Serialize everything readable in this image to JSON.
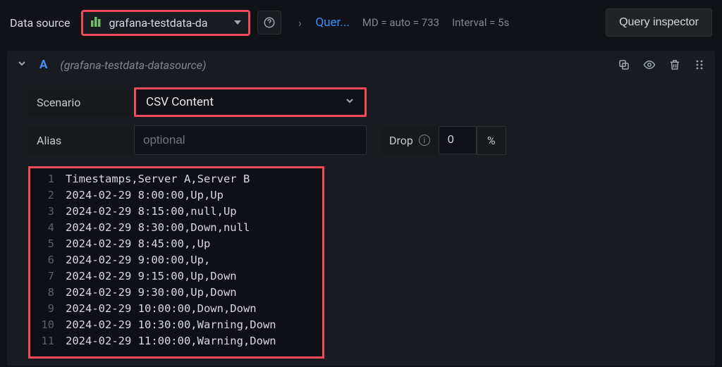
{
  "topbar": {
    "ds_label": "Data source",
    "ds_name": "grafana-testdata-da",
    "breadcrumb_link": "Quer...",
    "stat_md": "MD = auto = 733",
    "stat_interval": "Interval = 5s",
    "inspector_label": "Query inspector"
  },
  "query": {
    "letter": "A",
    "source": "(grafana-testdata-datasource)"
  },
  "scenario": {
    "label": "Scenario",
    "value": "CSV Content"
  },
  "alias": {
    "label": "Alias",
    "placeholder": "optional",
    "value": ""
  },
  "drop": {
    "label": "Drop",
    "value": "0",
    "unit": "%"
  },
  "csv_lines": [
    "Timestamps,Server A,Server B",
    "2024-02-29 8:00:00,Up,Up",
    "2024-02-29 8:15:00,null,Up",
    "2024-02-29 8:30:00,Down,null",
    "2024-02-29 8:45:00,,Up",
    "2024-02-29 9:00:00,Up,",
    "2024-02-29 9:15:00,Up,Down",
    "2024-02-29 9:30:00,Up,Down",
    "2024-02-29 10:00:00,Down,Down",
    "2024-02-29 10:30:00,Warning,Down",
    "2024-02-29 11:00:00,Warning,Down"
  ]
}
